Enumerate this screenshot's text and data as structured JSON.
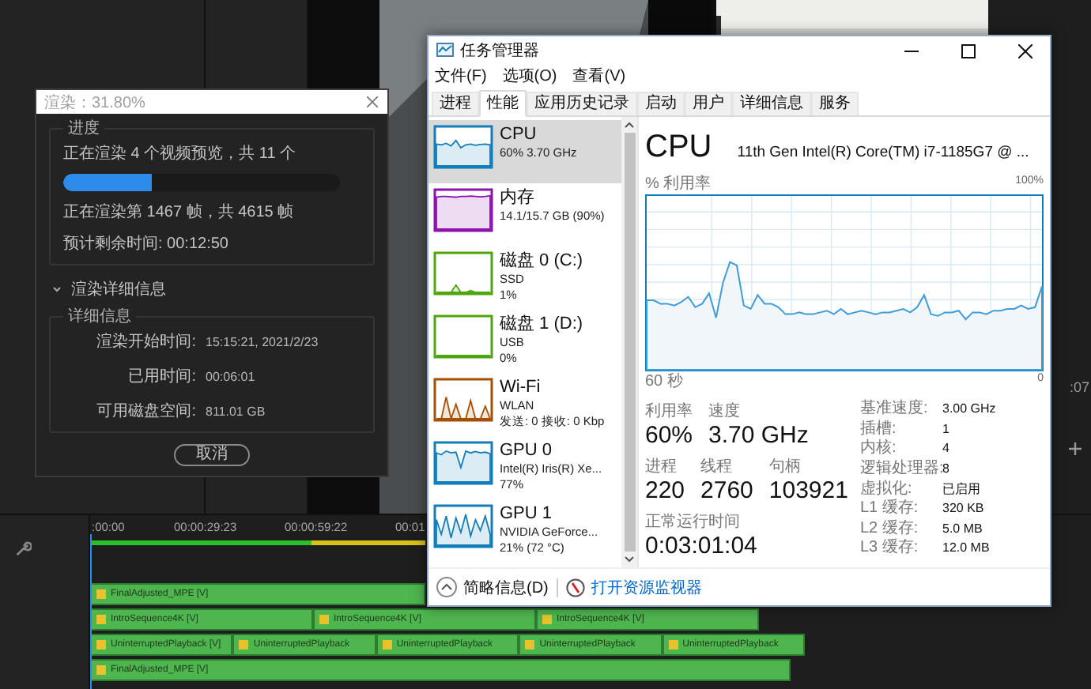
{
  "editor": {
    "side_timecode": ":07",
    "timeline": {
      "timecodes": [
        ":00:00",
        "00:00:29:23",
        "00:00:59:22",
        "00:01"
      ],
      "tracks": [
        {
          "clips": [
            "FinalAdjusted_MPE [V]"
          ]
        },
        {
          "clips": [
            "IntroSequence4K [V]",
            "IntroSequence4K [V]",
            "IntroSequence4K [V]"
          ]
        },
        {
          "clips": [
            "UninterruptedPlayback [V]",
            "UninterruptedPlayback",
            "UninterruptedPlayback",
            "UninterruptedPlayback",
            "UninterruptedPlayback"
          ]
        },
        {
          "clips": [
            "FinalAdjusted_MPE [V]"
          ]
        }
      ]
    }
  },
  "render_dialog": {
    "title": "渲染：31.80%",
    "progress_group": {
      "label": "进度",
      "status": "正在渲染 4 个视频预览，共 11 个",
      "level": 0.318,
      "frame_status": "正在渲染第 1467 帧，共 4615 帧",
      "remaining": "预计剩余时间: 00:12:50"
    },
    "details_toggle": {
      "label": "渲染详细信息",
      "expanded": true
    },
    "details_group": {
      "label": "详细信息",
      "rows": [
        {
          "label": "渲染开始时间:",
          "value": "15:15:21, 2021/2/23"
        },
        {
          "label": "已用时间:",
          "value": "00:06:01"
        },
        {
          "label": "可用磁盘空间:",
          "value": "811.01 GB"
        }
      ]
    },
    "cancel_button": "取消"
  },
  "task_manager": {
    "title": "任务管理器",
    "menu": [
      "文件(F)",
      "选项(O)",
      "查看(V)"
    ],
    "tabs": [
      {
        "label": "进程",
        "selected": false
      },
      {
        "label": "性能",
        "selected": true
      },
      {
        "label": "应用历史记录",
        "selected": false
      },
      {
        "label": "启动",
        "selected": false
      },
      {
        "label": "用户",
        "selected": false
      },
      {
        "label": "详细信息",
        "selected": false
      },
      {
        "label": "服务",
        "selected": false
      }
    ],
    "resources": [
      {
        "name": "CPU",
        "lines": [
          "60% 3.70 GHz"
        ],
        "color": "#117dbb",
        "selected": true
      },
      {
        "name": "内存",
        "lines": [
          "14.1/15.7 GB (90%)"
        ],
        "color": "#8b12ae",
        "selected": false
      },
      {
        "name": "磁盘 0 (C:)",
        "lines": [
          "SSD",
          "1%"
        ],
        "color": "#4da60c",
        "selected": false
      },
      {
        "name": "磁盘 1 (D:)",
        "lines": [
          "USB",
          "0%"
        ],
        "color": "#4da60c",
        "selected": false
      },
      {
        "name": "Wi-Fi",
        "lines": [
          "WLAN",
          "发送: 0 接收: 0 Kbp"
        ],
        "color": "#a74f01",
        "selected": false
      },
      {
        "name": "GPU 0",
        "lines": [
          "Intel(R) Iris(R) Xe...",
          "77%"
        ],
        "color": "#117dbb",
        "selected": false
      },
      {
        "name": "GPU 1",
        "lines": [
          "NVIDIA GeForce...",
          "21% (72 °C)"
        ],
        "color": "#117dbb",
        "selected": false
      }
    ],
    "detail": {
      "title": "CPU",
      "model": "11th Gen Intel(R) Core(TM) i7-1185G7 @ ...",
      "graph_label": "% 利用率",
      "graph_max": "100%",
      "axis_start": "60 秒",
      "axis_end": "0",
      "stat_rows": [
        [
          {
            "label": "利用率",
            "value": "60%"
          },
          {
            "label": "速度",
            "value": "3.70 GHz"
          }
        ],
        [
          {
            "label": "进程",
            "value": "220"
          },
          {
            "label": "线程",
            "value": "2760"
          },
          {
            "label": "句柄",
            "value": "103921"
          }
        ],
        [
          {
            "label": "正常运行时间",
            "value": "0:03:01:04"
          }
        ]
      ],
      "specs": [
        {
          "label": "基准速度:",
          "value": "3.00 GHz"
        },
        {
          "label": "插槽:",
          "value": "1"
        },
        {
          "label": "内核:",
          "value": "4"
        },
        {
          "label": "逻辑处理器:",
          "value": "8"
        },
        {
          "label": "虚拟化:",
          "value": "已启用"
        },
        {
          "label": "L1 缓存:",
          "value": "320 KB"
        },
        {
          "label": "L2 缓存:",
          "value": "5.0 MB"
        },
        {
          "label": "L3 缓存:",
          "value": "12.0 MB"
        }
      ]
    },
    "footer": {
      "summary": "简略信息(D)",
      "link": "打开资源监视器"
    }
  }
}
